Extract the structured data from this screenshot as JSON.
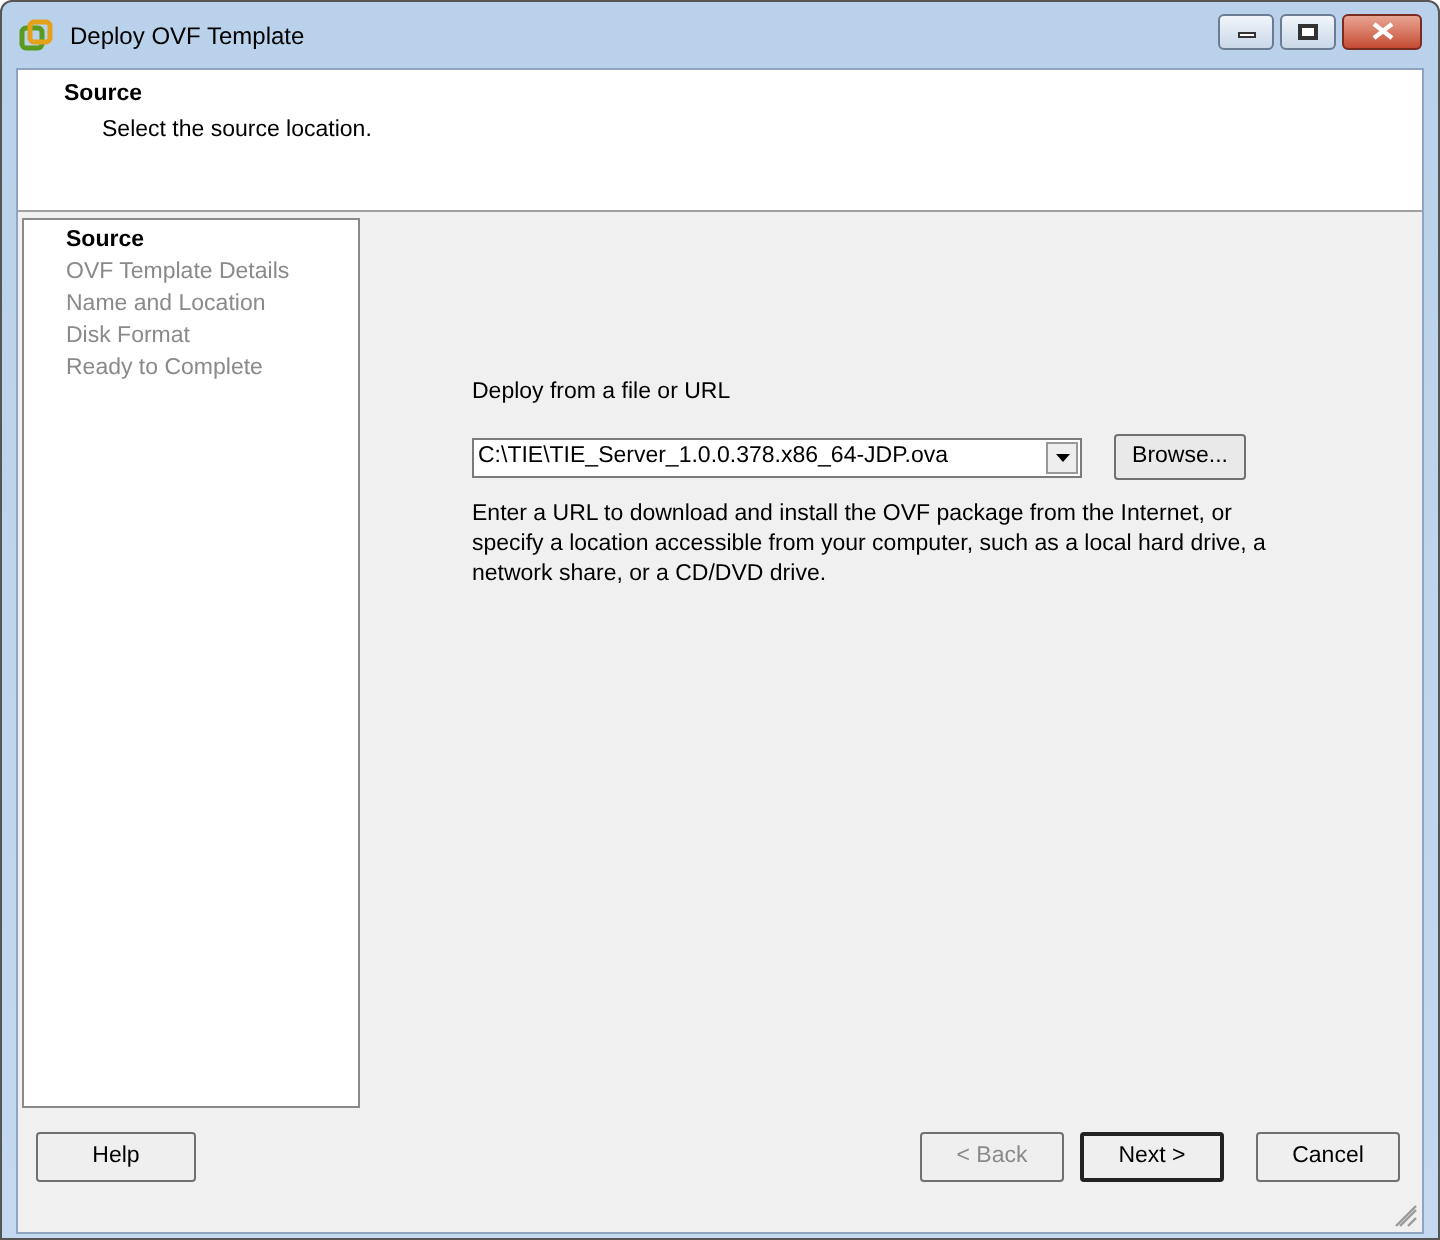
{
  "window": {
    "title": "Deploy OVF Template"
  },
  "header": {
    "title": "Source",
    "subtitle": "Select the source location."
  },
  "steps": [
    {
      "label": "Source",
      "selected": true
    },
    {
      "label": "OVF Template Details",
      "selected": false
    },
    {
      "label": "Name and Location",
      "selected": false
    },
    {
      "label": "Disk Format",
      "selected": false
    },
    {
      "label": "Ready to Complete",
      "selected": false
    }
  ],
  "source": {
    "label": "Deploy from a file or URL",
    "value": "C:\\TIE\\TIE_Server_1.0.0.378.x86_64-JDP.ova",
    "browse": "Browse...",
    "help_text": "Enter a URL to download and install the OVF package from the Internet, or specify a location accessible from your computer, such as a local hard drive, a network share, or a CD/DVD drive."
  },
  "buttons": [
    {
      "label": "Help",
      "kind": "help",
      "disabled": false,
      "default": false
    },
    {
      "label": "< Back",
      "kind": "back",
      "disabled": true,
      "default": false
    },
    {
      "label": "Next >",
      "kind": "next",
      "disabled": false,
      "default": true
    },
    {
      "label": "Cancel",
      "kind": "cancel",
      "disabled": false,
      "default": false
    }
  ]
}
